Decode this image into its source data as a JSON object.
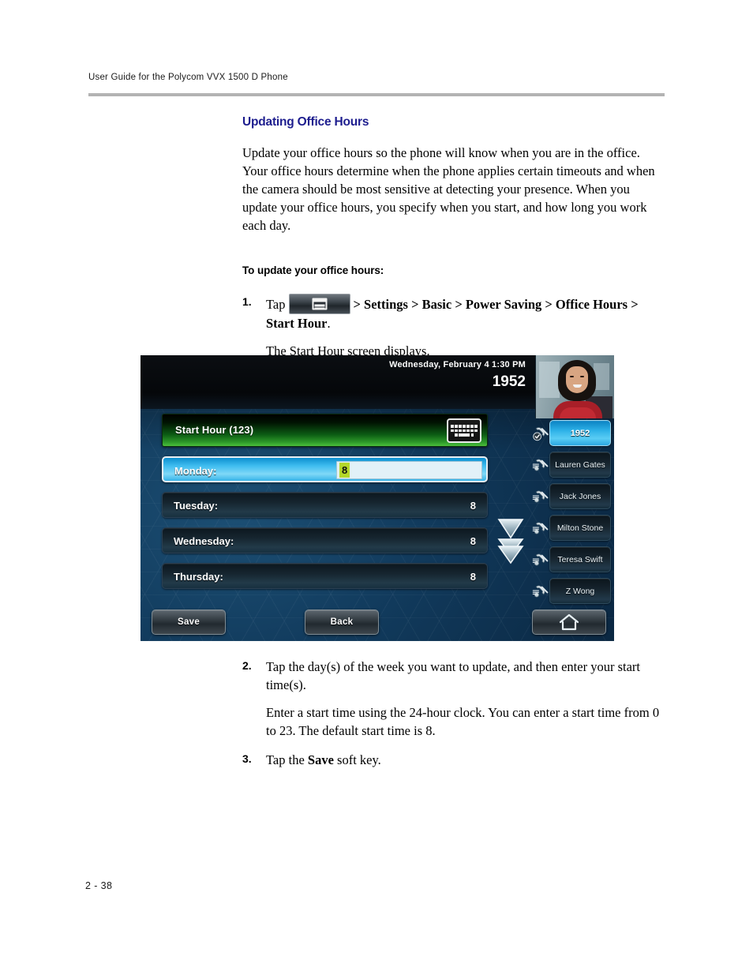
{
  "header": {
    "running_head": "User Guide for the Polycom VVX 1500 D Phone"
  },
  "footer": {
    "page_number": "2 - 38"
  },
  "content": {
    "section_title": "Updating Office Hours",
    "intro_paragraph": "Update your office hours so the phone will know when you are in the office. Your office hours determine when the phone applies certain timeouts and when the camera should be most sensitive at detecting your presence. When you update your office hours, you specify when you start, and how long you work each day.",
    "procedure_heading": "To update your office hours:",
    "steps": [
      {
        "number": "1.",
        "lead": "Tap",
        "icon": "menu-hard-key-icon",
        "path": "> Settings > Basic > Power Saving > Office Hours > Start Hour",
        "path_tail": ".",
        "result": "The Start Hour screen displays."
      },
      {
        "number": "2.",
        "text": "Tap the day(s) of the week you want to update, and then enter your start time(s).",
        "note": "Enter a start time using the 24-hour clock. You can enter a start time from 0 to 23. The default start time is 8."
      },
      {
        "number": "3.",
        "text_before": "Tap the ",
        "bold": "Save",
        "text_after": " soft key."
      }
    ]
  },
  "phone_screen": {
    "status_bar": {
      "date_time": "Wednesday, February 4  1:30 PM",
      "extension": "1952"
    },
    "title_bar": {
      "label": "Start Hour (123)",
      "keyboard_icon": "keyboard-icon"
    },
    "rows": [
      {
        "label": "Monday:",
        "value": "8",
        "selected": true,
        "editing": true
      },
      {
        "label": "Tuesday:",
        "value": "8",
        "selected": false,
        "editing": false
      },
      {
        "label": "Wednesday:",
        "value": "8",
        "selected": false,
        "editing": false
      },
      {
        "label": "Thursday:",
        "value": "8",
        "selected": false,
        "editing": false
      }
    ],
    "scroll": {
      "down_arrow": "chevron-down-icon",
      "page_down_arrow": "double-chevron-down-icon"
    },
    "contacts": [
      {
        "label": "1952",
        "active": true
      },
      {
        "label": "Lauren Gates",
        "active": false
      },
      {
        "label": "Jack Jones",
        "active": false
      },
      {
        "label": "Milton Stone",
        "active": false
      },
      {
        "label": "Teresa Swift",
        "active": false
      },
      {
        "label": "Z Wong",
        "active": false
      }
    ],
    "soft_keys": {
      "save": "Save",
      "back": "Back",
      "home_icon": "home-icon"
    },
    "colors": {
      "title_bar_green": "#2e9a2a",
      "selected_row_blue": "#3fbdf0",
      "edit_highlight": "#b4d72a",
      "screen_background": "#113a5c",
      "heading_blue": "#1d1d8e"
    }
  }
}
